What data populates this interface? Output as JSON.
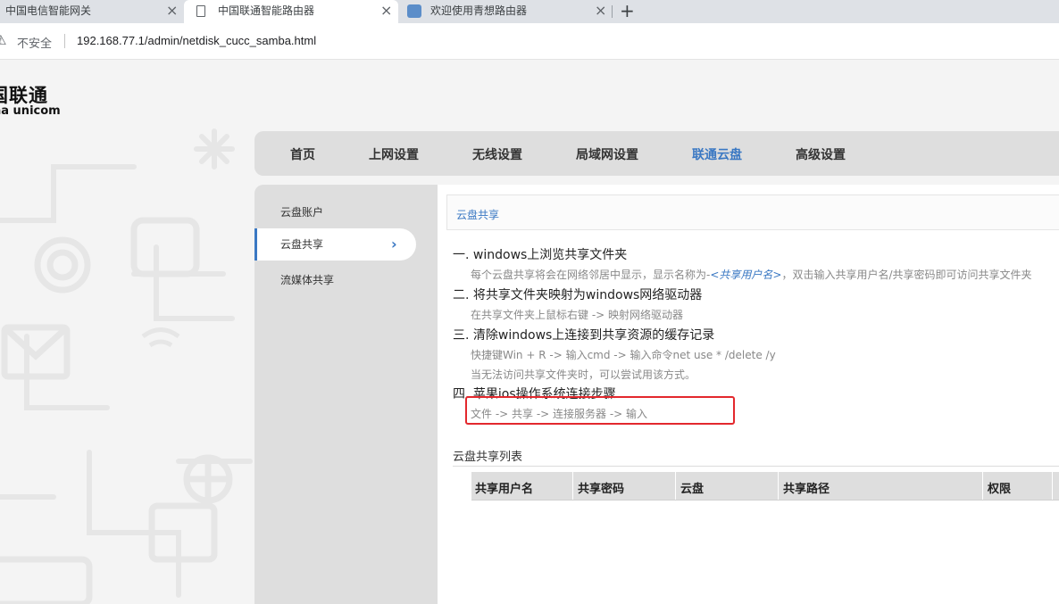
{
  "browser": {
    "tabs": [
      {
        "title": "中国电信智能网关",
        "close": "×",
        "active": false
      },
      {
        "title": "中国联通智能路由器",
        "close": "×",
        "active": true
      },
      {
        "title": "欢迎使用青想路由器",
        "close": "×",
        "active": false
      }
    ],
    "new_tab": "+",
    "security_icon": "⚠",
    "security_label": "不安全",
    "url": "192.168.77.1/admin/netdisk_cucc_samba.html"
  },
  "logo": {
    "cn": "国联通",
    "en": "na unicom"
  },
  "nav": {
    "items": [
      "首页",
      "上网设置",
      "无线设置",
      "局域网设置",
      "联通云盘",
      "高级设置"
    ],
    "active_index": 4
  },
  "sidebar": {
    "items": [
      {
        "label": "云盘账户",
        "active": false
      },
      {
        "label": "云盘共享",
        "active": true,
        "arrow": "›"
      },
      {
        "label": "流媒体共享",
        "active": false
      }
    ]
  },
  "content": {
    "header": "云盘共享",
    "steps": [
      {
        "title": "一. windows上浏览共享文件夹",
        "desc": [
          "每个云盘共享将会在网络邻居中显示，显示名称为-<共享用户名>，双击输入共享用户名/共享密码即可访问共享文件夹"
        ]
      },
      {
        "title": "二. 将共享文件夹映射为windows网络驱动器",
        "desc": [
          "在共享文件夹上鼠标右键 -> 映射网络驱动器"
        ]
      },
      {
        "title": "三. 清除windows上连接到共享资源的缓存记录",
        "desc": [
          "快捷键Win + R -> 输入cmd -> 输入命令net use * /delete /y",
          "当无法访问共享文件夹时，可以尝试用该方式。"
        ]
      },
      {
        "title": "四. 苹果ios操作系统连接步骤",
        "desc": [
          "文件 -> 共享 -> 连接服务器 -> 输入"
        ]
      }
    ],
    "step1_desc_parts": {
      "before": "每个云盘共享将会在网络邻居中显示，显示名称为-",
      "em": "<共享用户名>",
      "after": "，双击输入共享用户名/共享密码即可访问共享文件夹"
    },
    "list_title": "云盘共享列表",
    "table_headers": [
      "共享用户名",
      "共享密码",
      "云盘",
      "共享路径",
      "权限"
    ]
  },
  "colors": {
    "accent": "#3a78c3",
    "highlight": "#e3282d",
    "nav_bg": "#dedede",
    "page_bg": "#f4f4f4"
  }
}
